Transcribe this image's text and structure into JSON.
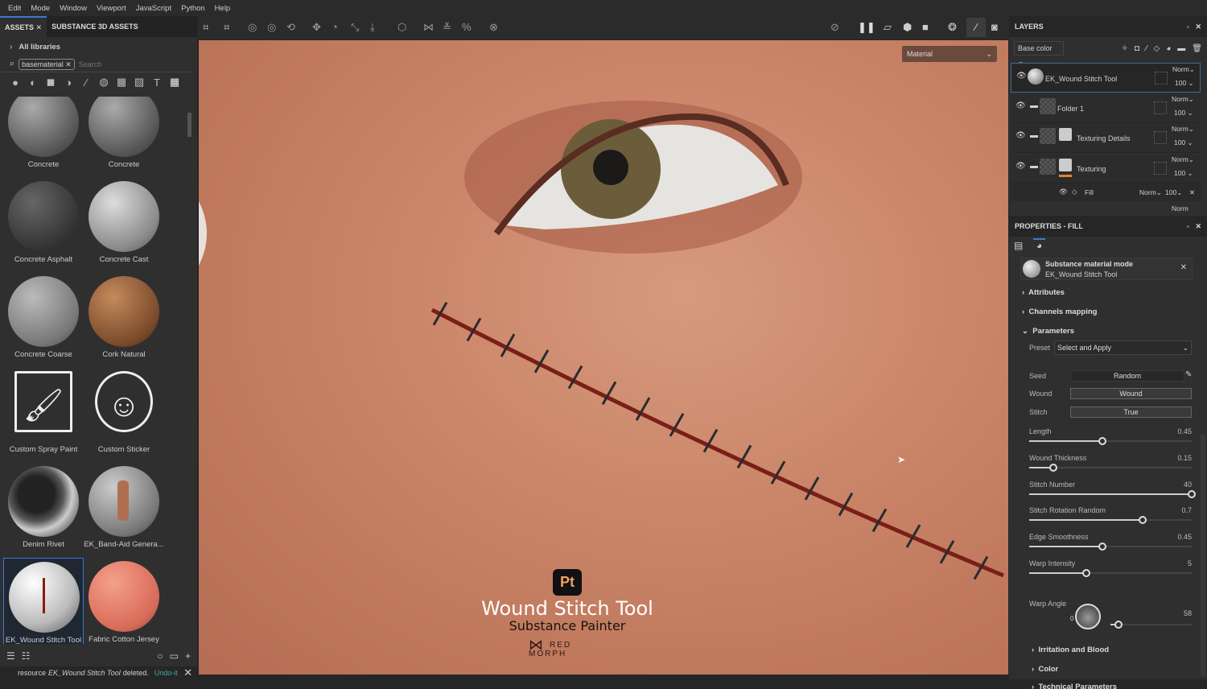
{
  "menu": [
    "Edit",
    "Mode",
    "Window",
    "Viewport",
    "JavaScript",
    "Python",
    "Help"
  ],
  "assets": {
    "tab_assets": "ASSETS",
    "tab_s3d": "SUBSTANCE 3D ASSETS",
    "libraries": "All libraries",
    "filter_tag": "basematerial",
    "search_placeholder": "Search",
    "items": [
      "Concrete",
      "Concrete",
      "Concrete Asphalt",
      "Concrete Cast",
      "Concrete Coarse",
      "Cork Natural",
      "Custom Spray Paint",
      "Custom Sticker",
      "Denim Rivet",
      "EK_Band-Aid Genera...",
      "EK_Wound Stitch Tool",
      "Fabric Cotton Jersey"
    ],
    "status": "resource",
    "status_item": "EK_Wound Stitch Tool",
    "status_suffix": "deleted.",
    "undo": "Undo-it"
  },
  "viewport": {
    "mode": "Material",
    "overlay_badge": "Pt",
    "overlay_title": "Wound Stitch Tool",
    "overlay_subtitle": "Substance Painter",
    "overlay_brand_1": "RED",
    "overlay_brand_2": "MORPH"
  },
  "layers": {
    "title": "LAYERS",
    "channel": "Base color",
    "items": [
      {
        "name": "EK_Wound Stitch Tool",
        "blend": "Norm",
        "opacity": "100"
      },
      {
        "name": "Folder 1",
        "blend": "Norm",
        "opacity": "100"
      },
      {
        "name": "Texturing Details",
        "blend": "Norm",
        "opacity": "100"
      },
      {
        "name": "Texturing",
        "blend": "Norm",
        "opacity": "100"
      }
    ],
    "fill": {
      "name": "Fill",
      "blend": "Norm",
      "opacity": "100"
    },
    "partial_blend": "Norm"
  },
  "properties": {
    "title": "PROPERTIES - FILL",
    "mode_title": "Substance material mode",
    "mode_name": "EK_Wound Stitch Tool",
    "sections": {
      "attributes": "Attributes",
      "channels": "Channels mapping",
      "parameters": "Parameters",
      "irritation": "Irritation and Blood",
      "color": "Color",
      "technical": "Technical Parameters"
    },
    "preset_label": "Preset",
    "preset_value": "Select and Apply",
    "seed_label": "Seed",
    "seed_value": "Random",
    "wound_label": "Wound",
    "wound_value": "Wound",
    "stitch_label": "Stitch",
    "stitch_value": "True",
    "sliders": [
      {
        "label": "Length",
        "value": "0.45",
        "fraction": 0.45
      },
      {
        "label": "Wound Thickness",
        "value": "0.15",
        "fraction": 0.15
      },
      {
        "label": "Stitch Number",
        "value": "40",
        "fraction": 1.0
      },
      {
        "label": "Stitch Rotation Random",
        "value": "0.7",
        "fraction": 0.7
      },
      {
        "label": "Edge Smoothness",
        "value": "0.45",
        "fraction": 0.45
      },
      {
        "label": "Warp Intensity",
        "value": "5",
        "fraction": 0.35
      }
    ],
    "warp_angle_label": "Warp Angle",
    "warp_angle_value": "58",
    "warp_angle_zero": "0",
    "warp_angle_fraction": 0.1
  }
}
